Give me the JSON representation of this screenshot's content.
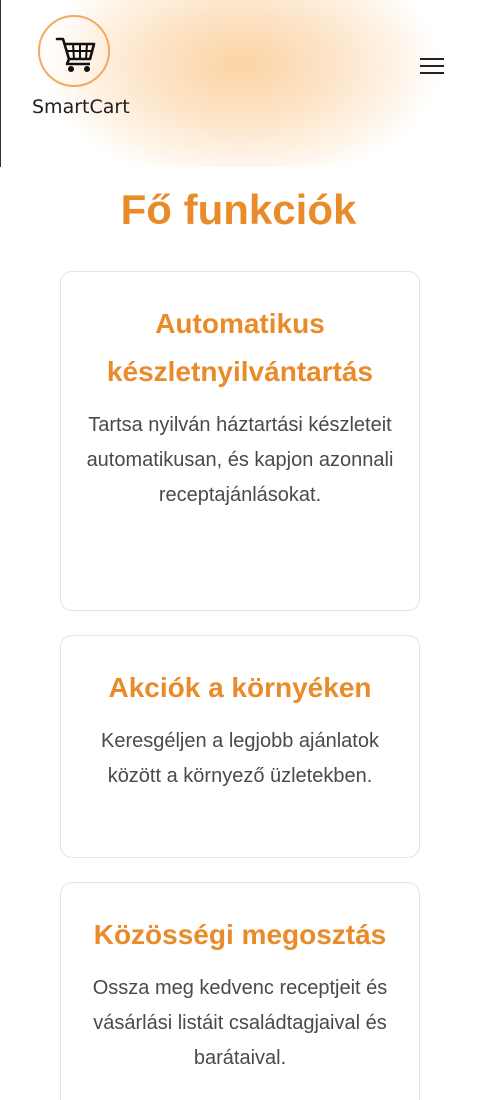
{
  "header": {
    "brand": "SmartCart",
    "logo_icon": "shopping-cart-icon",
    "menu_icon": "hamburger-menu-icon",
    "accent_color": "#ea8b2a"
  },
  "main": {
    "title": "Fő funkciók",
    "features": [
      {
        "title": "Automatikus készletnyilvántartás",
        "description": "Tartsa nyilván háztartási készleteit automatikusan, és kapjon azonnali receptajánlásokat."
      },
      {
        "title": "Akciók a környéken",
        "description": "Keresgéljen a legjobb ajánlatok között a környező üzletekben."
      },
      {
        "title": "Közösségi megosztás",
        "description": "Ossza meg kedvenc receptjeit és vásárlási listáit családtagjaival és barátaival."
      }
    ]
  }
}
